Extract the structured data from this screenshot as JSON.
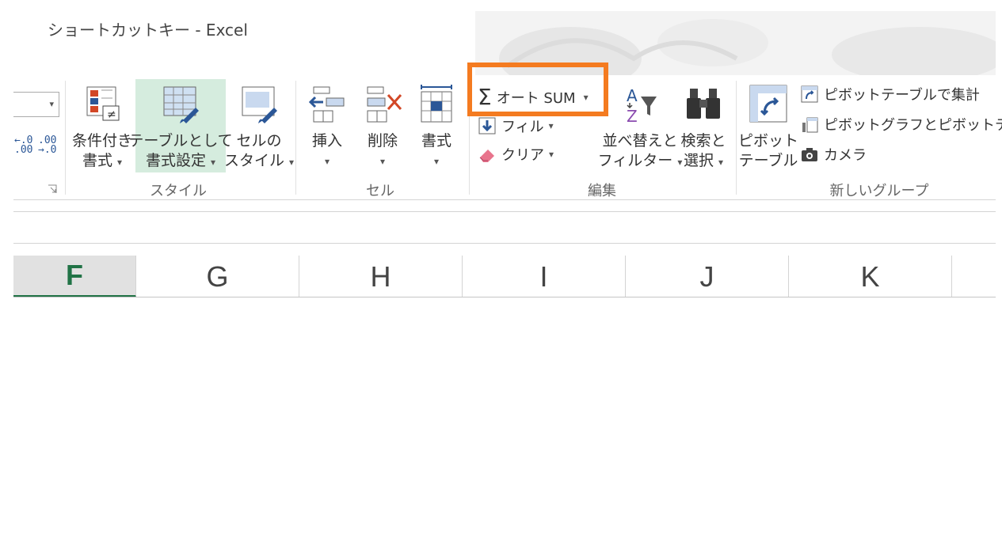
{
  "window": {
    "title": "ショートカットキー - Excel"
  },
  "ribbon": {
    "styles_group": {
      "label": "スタイル",
      "conditional_formatting": {
        "line1": "条件付き",
        "line2": "書式"
      },
      "format_as_table": {
        "line1": "テーブルとして",
        "line2": "書式設定"
      },
      "cell_styles": {
        "line1": "セルの",
        "line2": "スタイル"
      }
    },
    "cells_group": {
      "label": "セル",
      "insert": "挿入",
      "delete": "削除",
      "format": "書式"
    },
    "editing_group": {
      "label": "編集",
      "autosum": "オート SUM",
      "fill": "フィル",
      "clear": "クリア",
      "sort_filter": {
        "line1": "並べ替えと",
        "line2": "フィルター"
      },
      "find_select": {
        "line1": "検索と",
        "line2": "選択"
      }
    },
    "new_group": {
      "label": "新しいグループ",
      "pivot_table": {
        "line1": "ピボット",
        "line2": "テーブル"
      },
      "pivot_table_summary": "ピボットテーブルで集計",
      "pivot_chart": "ピボットグラフとピボットテーブ",
      "camera": "カメラ"
    },
    "number_format": {
      "increase_decimal": ".0\n.00",
      "decrease_decimal": ".00\n.0"
    }
  },
  "grid": {
    "columns": [
      "F",
      "G",
      "H",
      "I",
      "J",
      "K"
    ],
    "active_column": "F"
  },
  "colors": {
    "highlight_box": "#f47b20",
    "excel_green": "#217346",
    "selected_button_bg": "#d5ecde"
  }
}
